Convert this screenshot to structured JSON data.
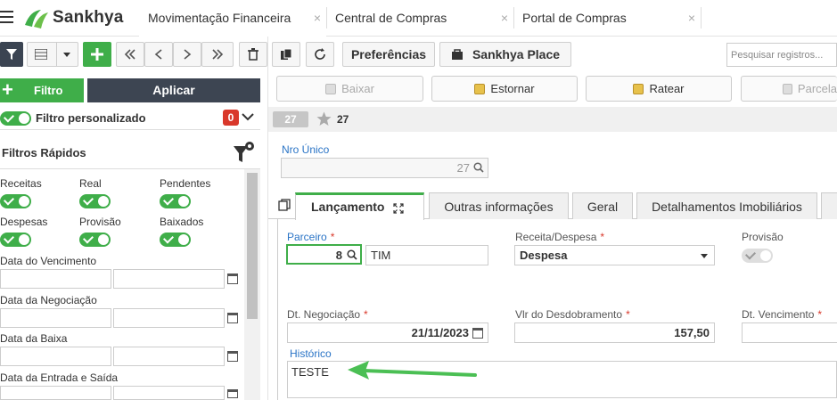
{
  "app": {
    "name": "Sankhya"
  },
  "tabs": [
    {
      "label": "Movimentação Financeira",
      "active": true
    },
    {
      "label": "Central de Compras",
      "active": false
    },
    {
      "label": "Portal de Compras",
      "active": false
    }
  ],
  "tab_close_glyph": "×",
  "toolbar": {
    "preferencias": "Preferências",
    "sankhya_place": "Sankhya Place",
    "search_placeholder": "Pesquisar registros..."
  },
  "left": {
    "filtro": "Filtro",
    "aplicar": "Aplicar",
    "filtro_personalizado": "Filtro personalizado",
    "badge_count": "0",
    "filtros_rapidos": "Filtros Rápidos",
    "quick": {
      "receitas": "Receitas",
      "real": "Real",
      "pendentes": "Pendentes",
      "despesas": "Despesas",
      "provisao": "Provisão",
      "baixados": "Baixados"
    },
    "dates": [
      "Data do Vencimento",
      "Data da Negociação",
      "Data da Baixa",
      "Data da Entrada e Saída"
    ]
  },
  "actions": {
    "baixar": "Baixar",
    "estornar": "Estornar",
    "ratear": "Ratear",
    "parcelar": "Parcela"
  },
  "record": {
    "badge": "27",
    "star_count": "27",
    "nro_unico_label": "Nro Único",
    "nro_unico_value": "27"
  },
  "form_tabs": [
    {
      "label": "Lançamento",
      "active": true
    },
    {
      "label": "Outras informações"
    },
    {
      "label": "Geral"
    },
    {
      "label": "Detalhamentos Imobiliários"
    }
  ],
  "form": {
    "parceiro_label": "Parceiro",
    "parceiro_code": "8",
    "parceiro_name": "TIM",
    "receita_despesa_label": "Receita/Despesa",
    "receita_despesa_value": "Despesa",
    "provisao_label": "Provisão",
    "dt_negociacao_label": "Dt. Negociação",
    "dt_negociacao_value": "21/11/2023",
    "vlr_desdobramento_label": "Vlr do Desdobramento",
    "vlr_desdobramento_value": "157,50",
    "dt_vencimento_label": "Dt. Vencimento",
    "historico_label": "Histórico",
    "historico_value": "TESTE"
  },
  "colors": {
    "accent_green": "#3fae49",
    "dark": "#3d4552",
    "required_red": "#d9382b",
    "link_blue": "#2a74c6"
  },
  "icons": [
    "menu-icon",
    "sankhya-logo-icon",
    "filter-icon",
    "grid-icon",
    "plus-icon",
    "first-icon",
    "prev-icon",
    "next-icon",
    "last-icon",
    "trash-icon",
    "copy-icon",
    "refresh-icon",
    "bag-icon",
    "search-icon",
    "calendar-icon",
    "star-icon",
    "expand-icon",
    "dropdown-icon",
    "arrow-annotation-icon"
  ]
}
